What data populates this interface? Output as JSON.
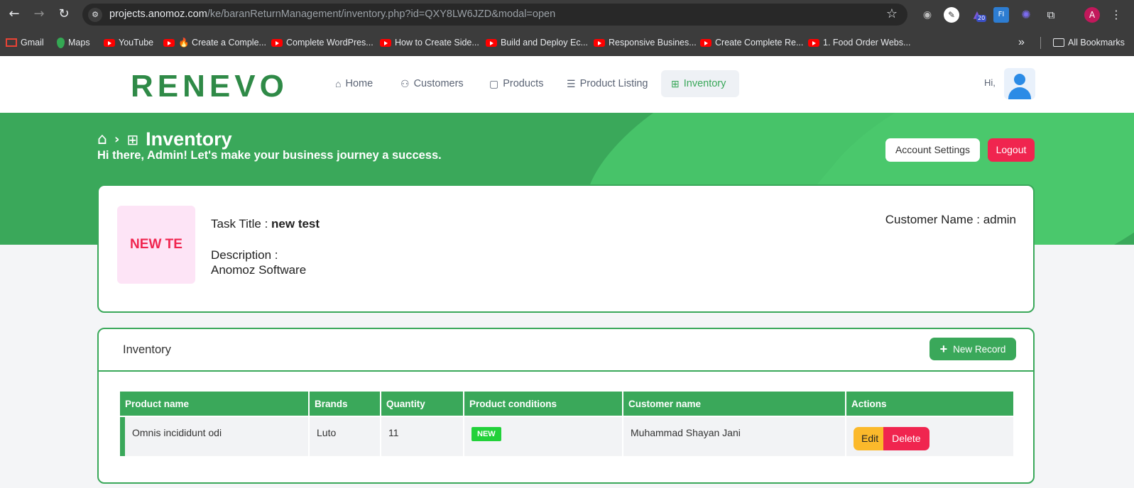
{
  "browser": {
    "url_host": "projects.anomoz.com",
    "url_path": "/ke/baranReturnManagement/inventory.php?id=QXY8LW6JZD&modal=open",
    "extension_badge": "20",
    "profile_initial": "A",
    "bookmarks": [
      {
        "label": "Gmail",
        "icon": "gmail-icon"
      },
      {
        "label": "Maps",
        "icon": "maps-icon"
      },
      {
        "label": "YouTube",
        "icon": "youtube-icon"
      },
      {
        "label": "🔥 Create a Comple...",
        "icon": "youtube-icon"
      },
      {
        "label": "Complete WordPres...",
        "icon": "youtube-icon"
      },
      {
        "label": "How to Create Side...",
        "icon": "youtube-icon"
      },
      {
        "label": "Build and Deploy Ec...",
        "icon": "youtube-icon"
      },
      {
        "label": "Responsive Busines...",
        "icon": "youtube-icon"
      },
      {
        "label": "Create Complete Re...",
        "icon": "youtube-icon"
      },
      {
        "label": "1. Food Order Webs...",
        "icon": "youtube-icon"
      }
    ],
    "more_bookmarks": "»",
    "all_bookmarks": "All Bookmarks"
  },
  "header": {
    "logo": "RENEVO",
    "nav": [
      {
        "label": "Home",
        "icon": "home-icon",
        "active": false
      },
      {
        "label": "Customers",
        "icon": "customers-icon",
        "active": false
      },
      {
        "label": "Products",
        "icon": "bag-icon",
        "active": false
      },
      {
        "label": "Product Listing",
        "icon": "list-icon",
        "active": false
      },
      {
        "label": "Inventory",
        "icon": "inventory-icon",
        "active": true
      }
    ],
    "greeting": "Hi,"
  },
  "banner": {
    "title": "Inventory",
    "subtitle": "Hi there, Admin! Let's make your business journey a success.",
    "account_settings": "Account Settings",
    "logout": "Logout"
  },
  "task": {
    "thumb_text": "NEW TE",
    "title_label": "Task Title : ",
    "title_value": "new test",
    "description_label": "Description :",
    "description_value": "Anomoz Software",
    "customer_label": "Customer Name : admin"
  },
  "inventory": {
    "title": "Inventory",
    "new_record": "New Record",
    "columns": [
      "Product name",
      "Brands",
      "Quantity",
      "Product conditions",
      "Customer name",
      "Actions"
    ],
    "rows": [
      {
        "product": "Omnis incididunt odi",
        "brand": "Luto",
        "quantity": "11",
        "condition": "NEW",
        "customer": "Muhammad Shayan Jani",
        "edit": "Edit",
        "delete": "Delete"
      }
    ]
  },
  "colors": {
    "brand_green": "#3aa85a",
    "brand_green_light": "#4ac86c",
    "danger": "#f0254f",
    "warning": "#fbb92b",
    "badge_green": "#22d13a"
  }
}
